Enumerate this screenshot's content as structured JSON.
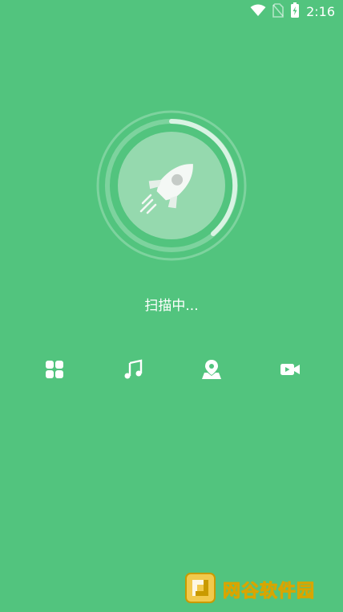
{
  "status_bar": {
    "time": "2:16",
    "icons": [
      "wifi-icon",
      "no-sim-icon",
      "battery-charging-icon"
    ]
  },
  "scan": {
    "status_text": "扫描中...",
    "icon": "rocket-icon"
  },
  "categories": [
    {
      "icon": "apps-grid-icon"
    },
    {
      "icon": "music-note-icon"
    },
    {
      "icon": "location-pin-icon"
    },
    {
      "icon": "video-camera-icon"
    }
  ],
  "watermark": {
    "text": "网谷软件园",
    "logo": "gold-square-logo"
  },
  "colors": {
    "background": "#52c47e",
    "ring_light": "#8fdca9",
    "circle_fill": "#95d9ae",
    "icon_white": "#ffffff",
    "watermark_gold": "#f2c94c"
  }
}
